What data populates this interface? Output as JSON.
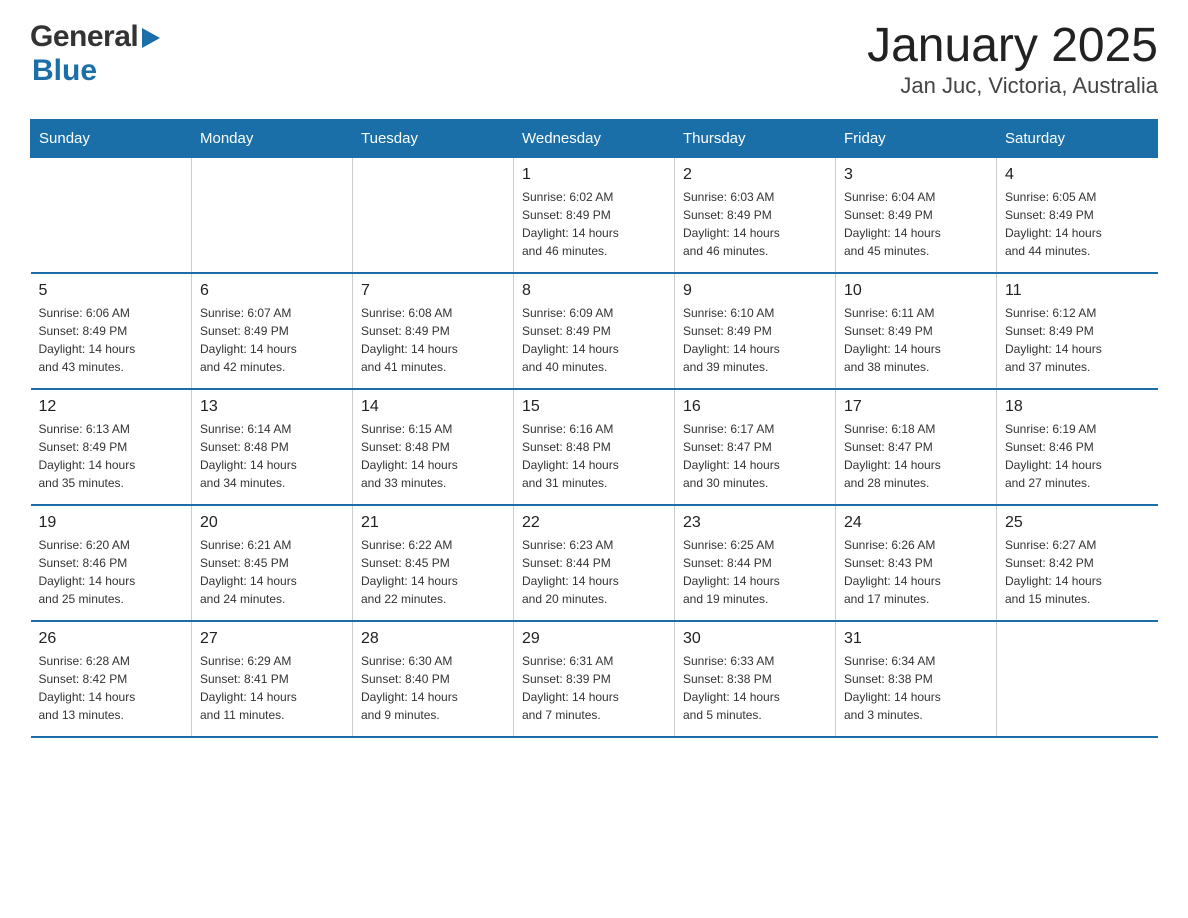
{
  "header": {
    "title": "January 2025",
    "subtitle": "Jan Juc, Victoria, Australia"
  },
  "logo": {
    "general": "General",
    "blue": "Blue"
  },
  "days_of_week": [
    "Sunday",
    "Monday",
    "Tuesday",
    "Wednesday",
    "Thursday",
    "Friday",
    "Saturday"
  ],
  "weeks": [
    {
      "days": [
        {
          "number": "",
          "info": ""
        },
        {
          "number": "",
          "info": ""
        },
        {
          "number": "",
          "info": ""
        },
        {
          "number": "1",
          "info": "Sunrise: 6:02 AM\nSunset: 8:49 PM\nDaylight: 14 hours\nand 46 minutes."
        },
        {
          "number": "2",
          "info": "Sunrise: 6:03 AM\nSunset: 8:49 PM\nDaylight: 14 hours\nand 46 minutes."
        },
        {
          "number": "3",
          "info": "Sunrise: 6:04 AM\nSunset: 8:49 PM\nDaylight: 14 hours\nand 45 minutes."
        },
        {
          "number": "4",
          "info": "Sunrise: 6:05 AM\nSunset: 8:49 PM\nDaylight: 14 hours\nand 44 minutes."
        }
      ]
    },
    {
      "days": [
        {
          "number": "5",
          "info": "Sunrise: 6:06 AM\nSunset: 8:49 PM\nDaylight: 14 hours\nand 43 minutes."
        },
        {
          "number": "6",
          "info": "Sunrise: 6:07 AM\nSunset: 8:49 PM\nDaylight: 14 hours\nand 42 minutes."
        },
        {
          "number": "7",
          "info": "Sunrise: 6:08 AM\nSunset: 8:49 PM\nDaylight: 14 hours\nand 41 minutes."
        },
        {
          "number": "8",
          "info": "Sunrise: 6:09 AM\nSunset: 8:49 PM\nDaylight: 14 hours\nand 40 minutes."
        },
        {
          "number": "9",
          "info": "Sunrise: 6:10 AM\nSunset: 8:49 PM\nDaylight: 14 hours\nand 39 minutes."
        },
        {
          "number": "10",
          "info": "Sunrise: 6:11 AM\nSunset: 8:49 PM\nDaylight: 14 hours\nand 38 minutes."
        },
        {
          "number": "11",
          "info": "Sunrise: 6:12 AM\nSunset: 8:49 PM\nDaylight: 14 hours\nand 37 minutes."
        }
      ]
    },
    {
      "days": [
        {
          "number": "12",
          "info": "Sunrise: 6:13 AM\nSunset: 8:49 PM\nDaylight: 14 hours\nand 35 minutes."
        },
        {
          "number": "13",
          "info": "Sunrise: 6:14 AM\nSunset: 8:48 PM\nDaylight: 14 hours\nand 34 minutes."
        },
        {
          "number": "14",
          "info": "Sunrise: 6:15 AM\nSunset: 8:48 PM\nDaylight: 14 hours\nand 33 minutes."
        },
        {
          "number": "15",
          "info": "Sunrise: 6:16 AM\nSunset: 8:48 PM\nDaylight: 14 hours\nand 31 minutes."
        },
        {
          "number": "16",
          "info": "Sunrise: 6:17 AM\nSunset: 8:47 PM\nDaylight: 14 hours\nand 30 minutes."
        },
        {
          "number": "17",
          "info": "Sunrise: 6:18 AM\nSunset: 8:47 PM\nDaylight: 14 hours\nand 28 minutes."
        },
        {
          "number": "18",
          "info": "Sunrise: 6:19 AM\nSunset: 8:46 PM\nDaylight: 14 hours\nand 27 minutes."
        }
      ]
    },
    {
      "days": [
        {
          "number": "19",
          "info": "Sunrise: 6:20 AM\nSunset: 8:46 PM\nDaylight: 14 hours\nand 25 minutes."
        },
        {
          "number": "20",
          "info": "Sunrise: 6:21 AM\nSunset: 8:45 PM\nDaylight: 14 hours\nand 24 minutes."
        },
        {
          "number": "21",
          "info": "Sunrise: 6:22 AM\nSunset: 8:45 PM\nDaylight: 14 hours\nand 22 minutes."
        },
        {
          "number": "22",
          "info": "Sunrise: 6:23 AM\nSunset: 8:44 PM\nDaylight: 14 hours\nand 20 minutes."
        },
        {
          "number": "23",
          "info": "Sunrise: 6:25 AM\nSunset: 8:44 PM\nDaylight: 14 hours\nand 19 minutes."
        },
        {
          "number": "24",
          "info": "Sunrise: 6:26 AM\nSunset: 8:43 PM\nDaylight: 14 hours\nand 17 minutes."
        },
        {
          "number": "25",
          "info": "Sunrise: 6:27 AM\nSunset: 8:42 PM\nDaylight: 14 hours\nand 15 minutes."
        }
      ]
    },
    {
      "days": [
        {
          "number": "26",
          "info": "Sunrise: 6:28 AM\nSunset: 8:42 PM\nDaylight: 14 hours\nand 13 minutes."
        },
        {
          "number": "27",
          "info": "Sunrise: 6:29 AM\nSunset: 8:41 PM\nDaylight: 14 hours\nand 11 minutes."
        },
        {
          "number": "28",
          "info": "Sunrise: 6:30 AM\nSunset: 8:40 PM\nDaylight: 14 hours\nand 9 minutes."
        },
        {
          "number": "29",
          "info": "Sunrise: 6:31 AM\nSunset: 8:39 PM\nDaylight: 14 hours\nand 7 minutes."
        },
        {
          "number": "30",
          "info": "Sunrise: 6:33 AM\nSunset: 8:38 PM\nDaylight: 14 hours\nand 5 minutes."
        },
        {
          "number": "31",
          "info": "Sunrise: 6:34 AM\nSunset: 8:38 PM\nDaylight: 14 hours\nand 3 minutes."
        },
        {
          "number": "",
          "info": ""
        }
      ]
    }
  ]
}
